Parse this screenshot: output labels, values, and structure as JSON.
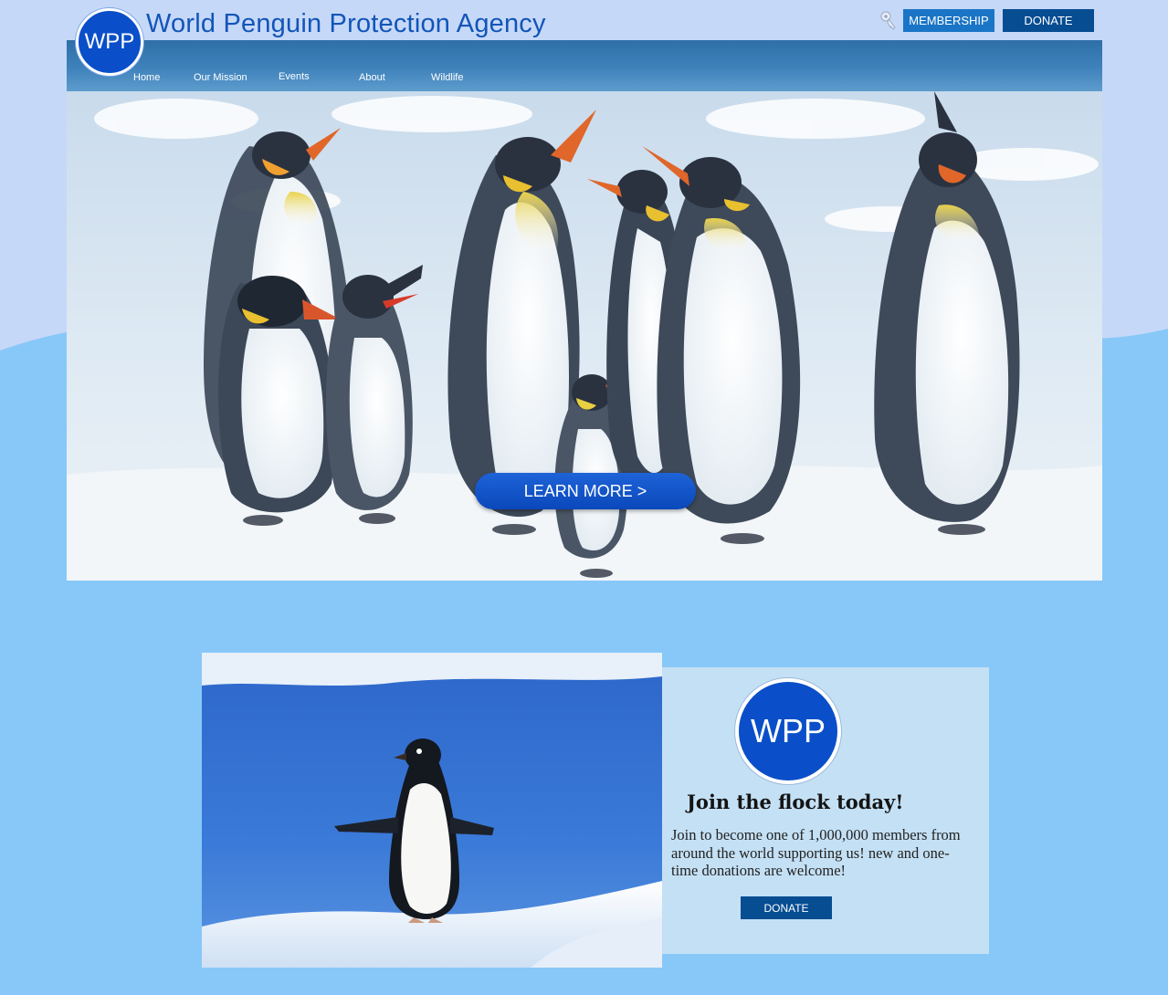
{
  "header": {
    "logo_text": "WPP",
    "site_title": "World Penguin Protection Agency",
    "membership_label": "MEMBERSHIP",
    "donate_label": "DONATE",
    "icons": {
      "search": "key-icon"
    }
  },
  "nav": {
    "items": [
      {
        "label": "Home"
      },
      {
        "label": "Our Mission"
      },
      {
        "label": "Events"
      },
      {
        "label": "About"
      },
      {
        "label": "Wildlife"
      }
    ]
  },
  "hero": {
    "cta_label": "LEARN MORE >"
  },
  "join": {
    "logo_text": "WPP",
    "heading": "Join the flock today!",
    "body": "Join to become one of 1,000,000 members from around the world supporting us! new and one-time donations are welcome!",
    "donate_label": "DONATE"
  },
  "colors": {
    "background": "#88c8f8",
    "brand_blue": "#0a4fc9",
    "donate_navy": "#064d92",
    "membership_blue": "#1a75c6",
    "title_blue": "#1255b8",
    "panel": "#c4e0f4"
  }
}
